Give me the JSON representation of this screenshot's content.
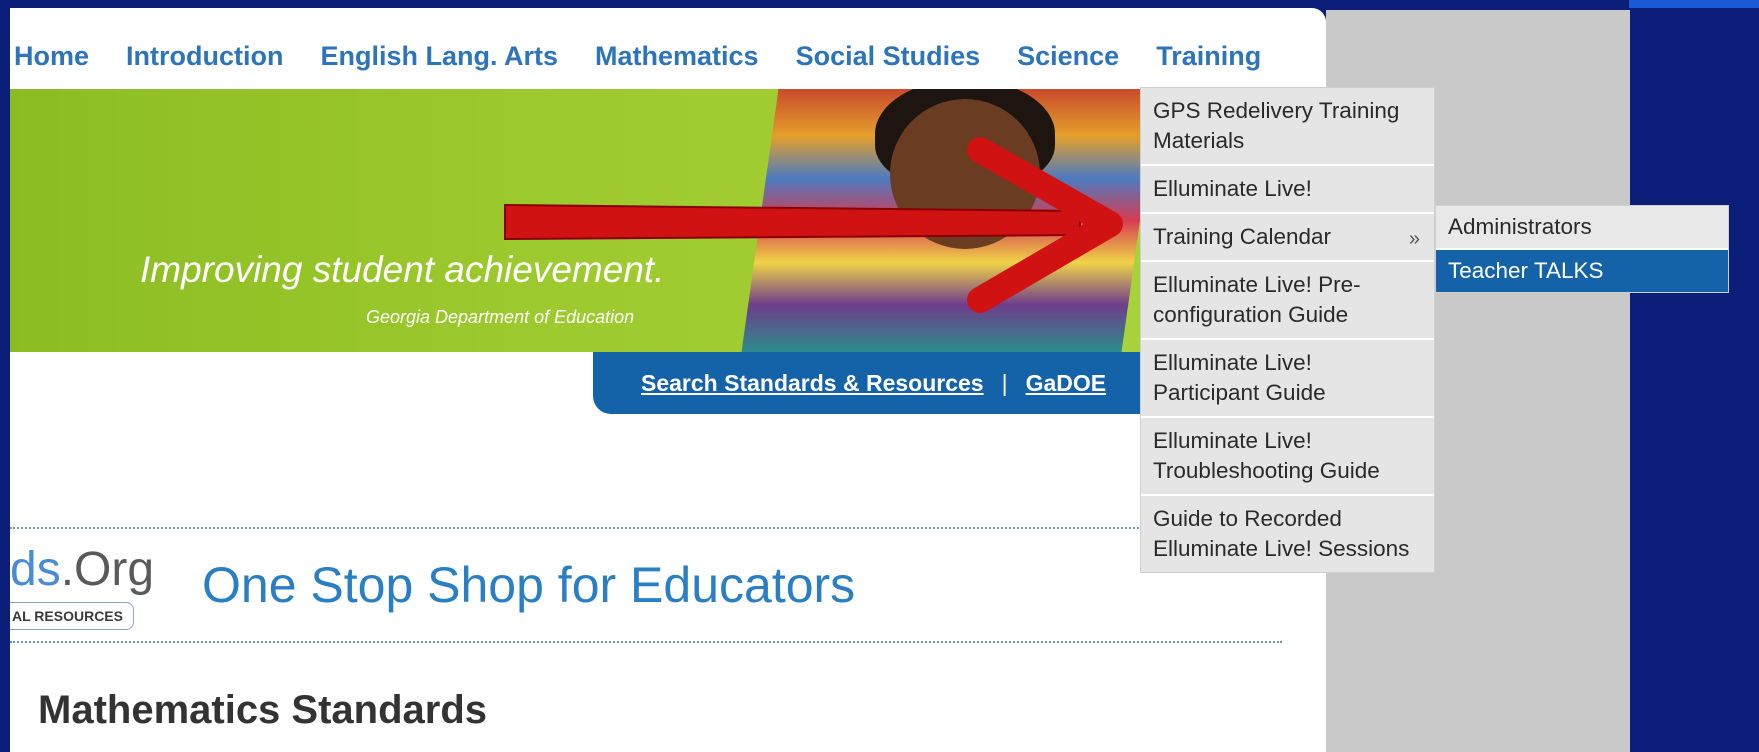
{
  "nav": {
    "items": [
      {
        "label": "Home"
      },
      {
        "label": "Introduction"
      },
      {
        "label": "English Lang. Arts"
      },
      {
        "label": "Mathematics"
      },
      {
        "label": "Social Studies"
      },
      {
        "label": "Science"
      },
      {
        "label": "Training"
      }
    ]
  },
  "banner": {
    "tagline": "Improving student achievement.",
    "subtext": "Georgia Department of Education"
  },
  "search_bar": {
    "link_label": "Search Standards & Resources",
    "separator": "|",
    "link2_label": "GaDOE"
  },
  "header": {
    "logo_text_prefix": "ds",
    "logo_text_suffix": ".Org",
    "logo_badge": "AL RESOURCES",
    "tagline": "One Stop Shop for Educators"
  },
  "main": {
    "title": "Mathematics Standards"
  },
  "training_menu": {
    "items": [
      {
        "label": "GPS Redelivery Training Materials"
      },
      {
        "label": "Elluminate Live!"
      },
      {
        "label": "Training Calendar",
        "arrow": "»"
      },
      {
        "label": "Elluminate Live! Pre-configuration Guide"
      },
      {
        "label": "Elluminate Live! Participant Guide"
      },
      {
        "label": "Elluminate Live! Troubleshooting Guide"
      },
      {
        "label": "Guide to Recorded Elluminate Live! Sessions"
      }
    ]
  },
  "submenu": {
    "items": [
      {
        "label": "Administrators"
      },
      {
        "label": "Teacher TALKS"
      }
    ]
  },
  "colors": {
    "background": "#0b1f7a",
    "nav_text": "#2d74b8",
    "banner_green": "#9cc92d",
    "search_bar": "#1463a8",
    "menu_bg": "#e5e5e5",
    "submenu_active": "#1463a8",
    "annotation_arrow": "#e41414"
  },
  "icons": {
    "submenu_arrow": "double-chevron-right-icon",
    "annotation": "red-arrow-icon"
  }
}
